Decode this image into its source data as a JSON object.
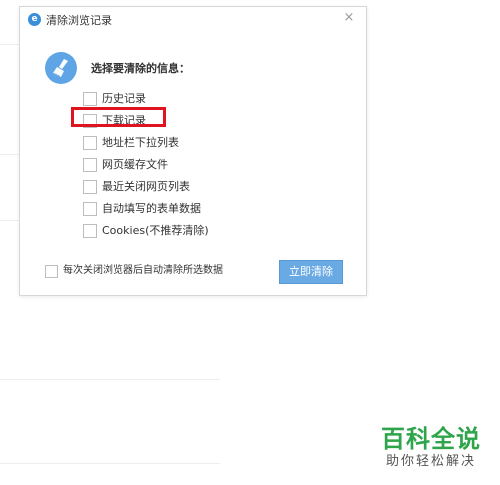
{
  "dialog": {
    "title": "清除浏览记录",
    "close_label": "×",
    "prompt": "选择要清除的信息：",
    "options": [
      {
        "label": "历史记录"
      },
      {
        "label": "下载记录"
      },
      {
        "label": "地址栏下拉列表"
      },
      {
        "label": "网页缓存文件"
      },
      {
        "label": "最近关闭网页列表"
      },
      {
        "label": "自动填写的表单数据"
      },
      {
        "label": "Cookies(不推荐清除)"
      }
    ],
    "auto_clear_label": "每次关闭浏览器后自动清除所选数据",
    "clear_button": "立即清除"
  },
  "watermark": {
    "main": "百科全说",
    "sub": "助你轻松解决"
  },
  "colors": {
    "accent": "#6aaae4",
    "highlight": "#e0141e",
    "watermark": "#2ea54a"
  }
}
